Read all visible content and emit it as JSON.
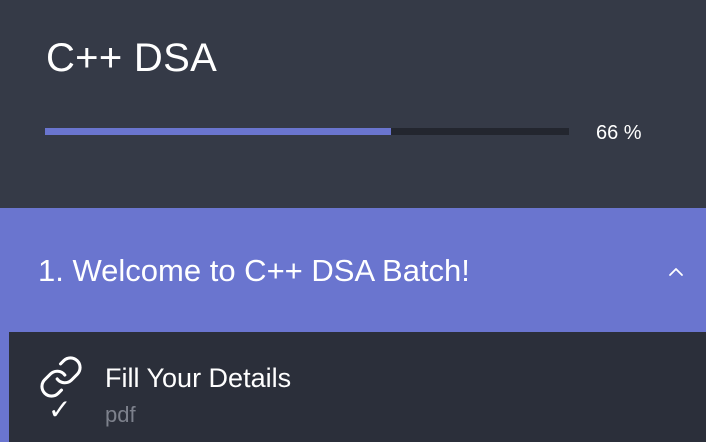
{
  "course": {
    "title": "C++ DSA",
    "progress_percent": 66,
    "progress_label": "66 %"
  },
  "section": {
    "title": "1. Welcome to C++ DSA Batch!",
    "expanded": true,
    "chevron_icon": "chevron-up-icon"
  },
  "lectures": [
    {
      "title": "Fill Your Details",
      "type": "pdf",
      "icon": "link-icon",
      "completed": true,
      "status_icon": "checkmark-icon"
    }
  ],
  "colors": {
    "background": "#353a47",
    "accent": "#6a75cf",
    "track": "#23262f",
    "list_background": "#2b2f3a",
    "muted_text": "#7d818c"
  }
}
